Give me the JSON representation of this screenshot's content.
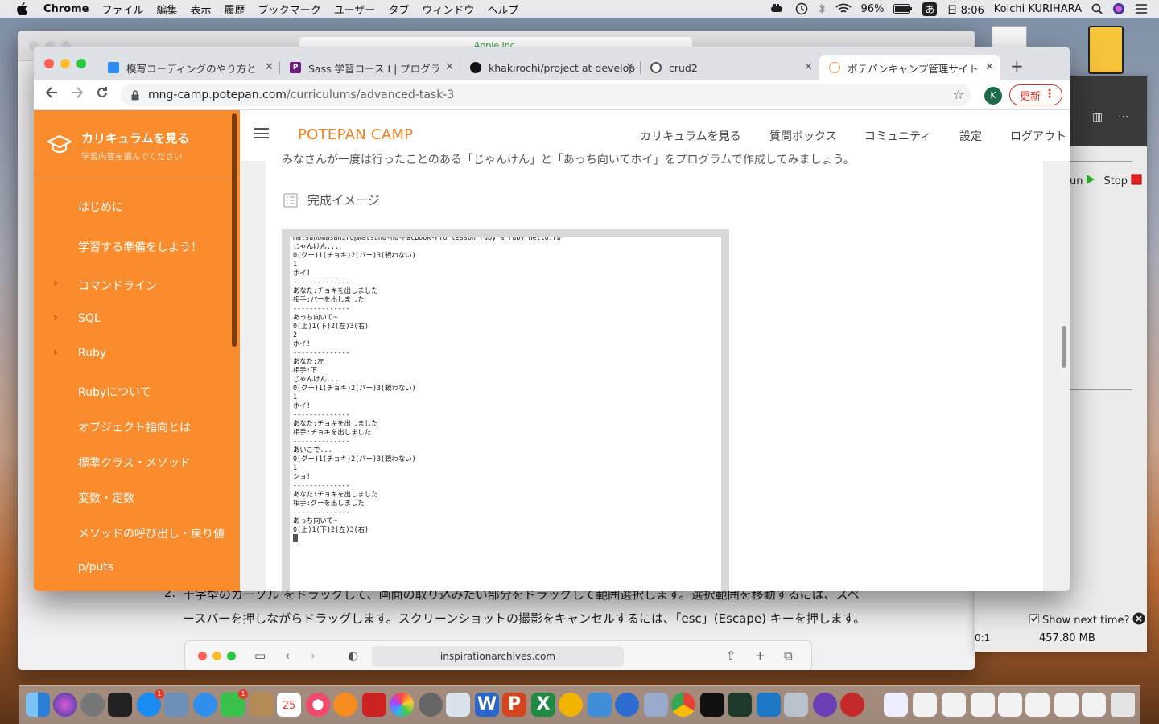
{
  "menubar": {
    "app": "Chrome",
    "items": [
      "ファイル",
      "編集",
      "表示",
      "履歴",
      "ブックマーク",
      "ユーザー",
      "タブ",
      "ウィンドウ",
      "ヘルプ"
    ],
    "battery": "96%",
    "ime": "あ",
    "clock": "日 8:06",
    "user": "Koichi KURIHARA"
  },
  "bg_window": {
    "url": "Apple Inc.",
    "step_number": "2.",
    "step_line1": "十字型のカーソル  をドラッグして、画面の取り込みたい部分をドラッグして範囲選択します。選択範囲を移動するには、スペ",
    "step_line2": "ースバーを押しながらドラッグします。スクリーンショットの撮影をキャンセルするには、「esc」(Escape) キーを押します。",
    "safari_url": "inspirationarchives.com"
  },
  "right_panel": {
    "run_label": "un",
    "stop_label": "Stop",
    "show_next": "Show next time?",
    "memory": "457.80 MB",
    "ratio": "0:1"
  },
  "tabs": [
    {
      "title": "模写コーディングのやり方と",
      "favicon_color": "#2d8cf0"
    },
    {
      "title": "Sass 学習コース I | プログラ",
      "favicon_color": "#6b1f7a"
    },
    {
      "title": "khakirochi/project at develop",
      "favicon_color": "#111111"
    },
    {
      "title": "crud2",
      "favicon_color": "#555555"
    },
    {
      "title": "ポテパンキャンプ管理サイト",
      "favicon_color": "#ffffff"
    }
  ],
  "address": {
    "host": "mng-camp.potepan.com",
    "path": "/curriculums/advanced-task-3",
    "avatar": "K",
    "update_label": "更新"
  },
  "sidebar": {
    "title": "カリキュラムを見る",
    "subtitle": "学習内容を選んでください",
    "items": [
      {
        "label": "はじめに",
        "chevron": false
      },
      {
        "label": "学習する準備をしよう！",
        "chevron": false
      },
      {
        "label": "コマンドライン",
        "chevron": true
      },
      {
        "label": "SQL",
        "chevron": true
      },
      {
        "label": "Ruby",
        "chevron": true
      },
      {
        "label": "Rubyについて",
        "chevron": false
      },
      {
        "label": "オブジェクト指向とは",
        "chevron": false
      },
      {
        "label": "標準クラス・メソッド",
        "chevron": false
      },
      {
        "label": "変数・定数",
        "chevron": false
      },
      {
        "label": "メソッドの呼び出し・戻り値",
        "chevron": false
      },
      {
        "label": "p/puts",
        "chevron": false
      }
    ]
  },
  "topnav": {
    "brand": "POTEPAN CAMP",
    "links": [
      "カリキュラムを見る",
      "質問ボックス",
      "コミュニティ",
      "設定",
      "ログアウト"
    ]
  },
  "content": {
    "cut_text": "みなさんが一度は行ったことのある「じゃんけん」と「あっち向いてホイ」をプログラムで作成してみましょう。",
    "section_title": "完成イメージ",
    "terminal_lines": [
      "matsunomasahiro@matsuno-no-MacBook-Pro lesson_ruby % ruby hello.rb",
      "じゃんけん...",
      "0(グー)1(チョキ)2(パー)3(戦わない)",
      "1",
      "ホイ!",
      "--------------",
      "あなた:チョキを出しました",
      "相手:パーを出しました",
      "--------------",
      "あっち向いて~",
      "0(上)1(下)2(左)3(右)",
      "2",
      "ホイ!",
      "--------------",
      "あなた:左",
      "相手:下",
      "じゃんけん...",
      "0(グー)1(チョキ)2(パー)3(戦わない)",
      "1",
      "ホイ!",
      "--------------",
      "あなた:チョキを出しました",
      "相手:チョキを出しました",
      "--------------",
      "あいこで...",
      "0(グー)1(チョキ)2(パー)3(戦わない)",
      "1",
      "ショ!",
      "--------------",
      "あなた:チョキを出しました",
      "相手:グーを出しました",
      "--------------",
      "あっち向いて~",
      "0(上)1(下)2(左)3(右)"
    ]
  },
  "colors": {
    "sidebar": "#fb8c2d",
    "brand": "#f07f1d",
    "chevron": "#e6341a",
    "update": "#d93025"
  },
  "dock": {
    "calendar_day": "25",
    "badges": [
      "1",
      "1"
    ]
  }
}
